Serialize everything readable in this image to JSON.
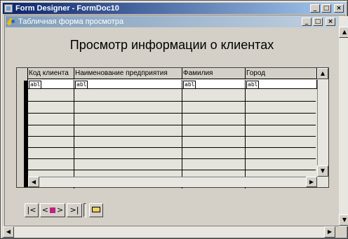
{
  "window": {
    "title": "Form Designer - FormDoc10"
  },
  "child": {
    "title": "Табличная форма просмотра"
  },
  "form": {
    "heading": "Просмотр информации о клиентах"
  },
  "grid": {
    "columns": [
      "Код клиента",
      "Наименование предприятия",
      "Фамилия",
      "Город"
    ],
    "textbox_glyph": "abl"
  },
  "nav": {
    "first": "|<",
    "prev": "<",
    "next": ">",
    "last": ">|"
  },
  "colors": {
    "titlebar_start": "#0a246a",
    "child_titlebar_start": "#7f9db9",
    "face": "#d4d0c8",
    "grid_bg": "#e4e4dc"
  }
}
